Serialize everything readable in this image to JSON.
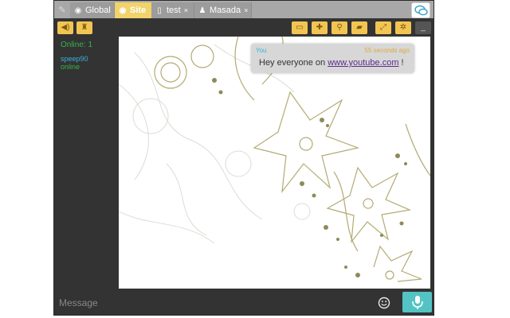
{
  "tabs": [
    {
      "icon": "globe-icon",
      "label": "Global",
      "active": false,
      "closable": false
    },
    {
      "icon": "globe-icon",
      "label": "Site",
      "active": true,
      "closable": false
    },
    {
      "icon": "file-icon",
      "label": "test",
      "active": false,
      "closable": true
    },
    {
      "icon": "user-icon",
      "label": "Masada",
      "active": false,
      "closable": true
    }
  ],
  "sidebar": {
    "online_label": "Online: 1",
    "user_name": "speep90",
    "user_status": "online"
  },
  "message": {
    "author": "You",
    "time": "55 seconds ago",
    "text_before": "Hey everyone on ",
    "link_text": "www.youtube.com",
    "text_after": " !"
  },
  "input": {
    "placeholder": "Message"
  },
  "colors": {
    "accent": "#f2c552",
    "active_tab": "#f2d36b",
    "dark_bg": "#333333",
    "mic": "#54c3c4",
    "link": "#5a2b8a",
    "online": "#37b34a",
    "username": "#38b3d6"
  }
}
